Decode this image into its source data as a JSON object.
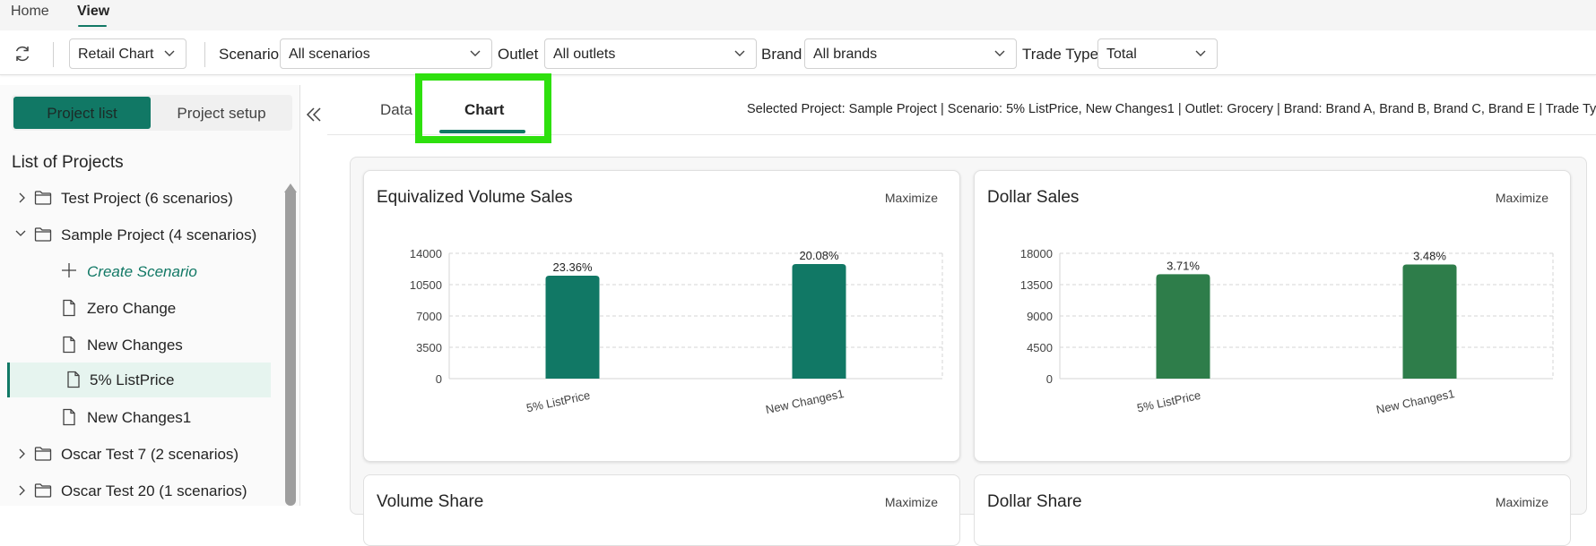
{
  "menu": {
    "home": "Home",
    "view": "View"
  },
  "toolbar": {
    "view_select": "Retail Chart",
    "scenario_label": "Scenario",
    "scenario_value": "All scenarios",
    "outlet_label": "Outlet",
    "outlet_value": "All outlets",
    "brand_label": "Brand",
    "brand_value": "All brands",
    "trade_label": "Trade Type",
    "trade_value": "Total"
  },
  "left": {
    "project_list": "Project list",
    "project_setup": "Project setup",
    "title": "List of Projects",
    "items": [
      {
        "label": "Test Project (6 scenarios)"
      },
      {
        "label": "Sample Project (4 scenarios)"
      },
      {
        "label": "Create Scenario"
      },
      {
        "label": "Zero Change"
      },
      {
        "label": "New Changes"
      },
      {
        "label": "5% ListPrice"
      },
      {
        "label": "New Changes1"
      },
      {
        "label": "Oscar Test 7 (2 scenarios)"
      },
      {
        "label": "Oscar Test 20 (1 scenarios)"
      }
    ]
  },
  "main": {
    "tabs": [
      {
        "label": "Data"
      },
      {
        "label": "Chart"
      }
    ],
    "selection_info": "Selected Project: Sample Project | Scenario: 5% ListPrice, New Changes1 | Outlet: Grocery | Brand: Brand A, Brand B, Brand C, Brand E | Trade Type: Total",
    "maximize": "Maximize",
    "lower_cards": [
      "Volume Share",
      "Dollar Share"
    ]
  },
  "colors": {
    "accent": "#117865",
    "volume_bar": "#117865",
    "dollar_bar": "#2e7d4a",
    "highlight": "#2ee00e"
  },
  "chart_data": [
    {
      "type": "bar",
      "title": "Equivalized Volume Sales",
      "categories": [
        "5% ListPrice",
        "New Changes1"
      ],
      "values": [
        11500,
        12800
      ],
      "data_labels": [
        "23.36%",
        "20.08%"
      ],
      "yticks": [
        "0",
        "3500",
        "7000",
        "10500",
        "14000"
      ],
      "ylim": [
        0,
        14000
      ],
      "grid": true
    },
    {
      "type": "bar",
      "title": "Dollar Sales",
      "categories": [
        "5% ListPrice",
        "New Changes1"
      ],
      "values": [
        15000,
        16400
      ],
      "data_labels": [
        "3.71%",
        "3.48%"
      ],
      "yticks": [
        "0",
        "4500",
        "9000",
        "13500",
        "18000"
      ],
      "ylim": [
        0,
        18000
      ],
      "grid": true
    }
  ]
}
